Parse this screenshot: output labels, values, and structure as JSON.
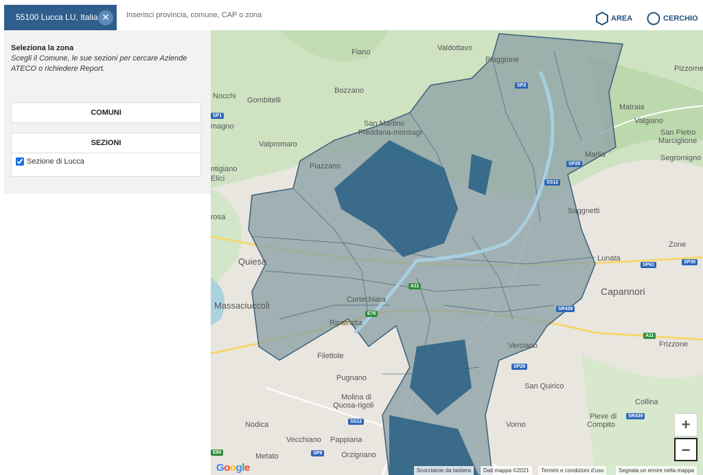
{
  "topbar": {
    "selected_area": "55100 Lucca LU, Italia",
    "close_glyph": "✕",
    "search_placeholder": "Inserisci provincia, comune, CAP o zona",
    "tools": [
      {
        "label": "AREA",
        "icon": "hexagon-icon"
      },
      {
        "label": "CERCHIO",
        "icon": "circle-icon"
      }
    ]
  },
  "panel": {
    "title": "Seleziona la zona",
    "description": "Scegli il Comune, le sue sezioni per cercare Aziende ATECO o richiedere Report.",
    "comuni_label": "COMUNI",
    "sezioni_label": "SEZIONI",
    "sezioni_items": [
      {
        "label": "Sezione di Lucca",
        "checked": true
      }
    ]
  },
  "map": {
    "labels": {
      "valdottavo": "Valdottavo",
      "fiano": "Fiano",
      "piaggione": "Piaggione",
      "pizzorne": "Pizzorne",
      "nocchi": "Nocchi",
      "bozzano": "Bozzano",
      "gombitelli": "Gombitelli",
      "matraia": "Matraia",
      "magno": "magno",
      "valgiano": "Valgiano",
      "san_martino": "San Martino",
      "freddana": "Freddana-monsagr",
      "san_pietro": "San Pietro",
      "marciglione": "Marciglione",
      "valpromaro": "Valpromaro",
      "segromigno": "Segromigno",
      "marlia": "Marlia",
      "ntigiano": "ntigiano",
      "elici": "Elici",
      "piazzano": "Piazzano",
      "sangonetti": "Saggnetti",
      "rosa": "rosa",
      "zone": "Zone",
      "quiesa": "Quiesa",
      "lunata": "Lunata",
      "massaciuccoli": "Massaciuccoli",
      "capannori": "Capannori",
      "ripafratta": "Ripafratta",
      "filettole": "Filettole",
      "frizzone": "Frizzone",
      "verciano": "Verciano",
      "pugnano": "Pugnano",
      "san_quirico": "San Quirico",
      "molina": "Molina di",
      "quosa": "Quosa-rigoli",
      "collina": "Collina",
      "nodica": "Nodica",
      "pieve": "Pieve di",
      "compito": "Compito",
      "vorno": "Vorno",
      "vecchiano": "Vecchiano",
      "pappiana": "Pappiana",
      "metato": "Metato",
      "orzignano": "Orzignano",
      "cortechiara": "Cortechiara"
    },
    "roads": [
      "SP2",
      "SP1",
      "SP29",
      "SS12",
      "SP61",
      "SP30",
      "A11",
      "E76",
      "SR439",
      "SP26",
      "A11",
      "SS12",
      "SP9",
      "E80",
      "SR439"
    ],
    "zoom_in": "+",
    "zoom_out": "−",
    "google_logo": "Google",
    "attribution": {
      "shortcuts": "Scorciatoie da tastiera",
      "data": "Dati mappa ©2021",
      "terms": "Termini e condizioni d'uso",
      "report": "Segnala un errore nella mappa"
    }
  }
}
